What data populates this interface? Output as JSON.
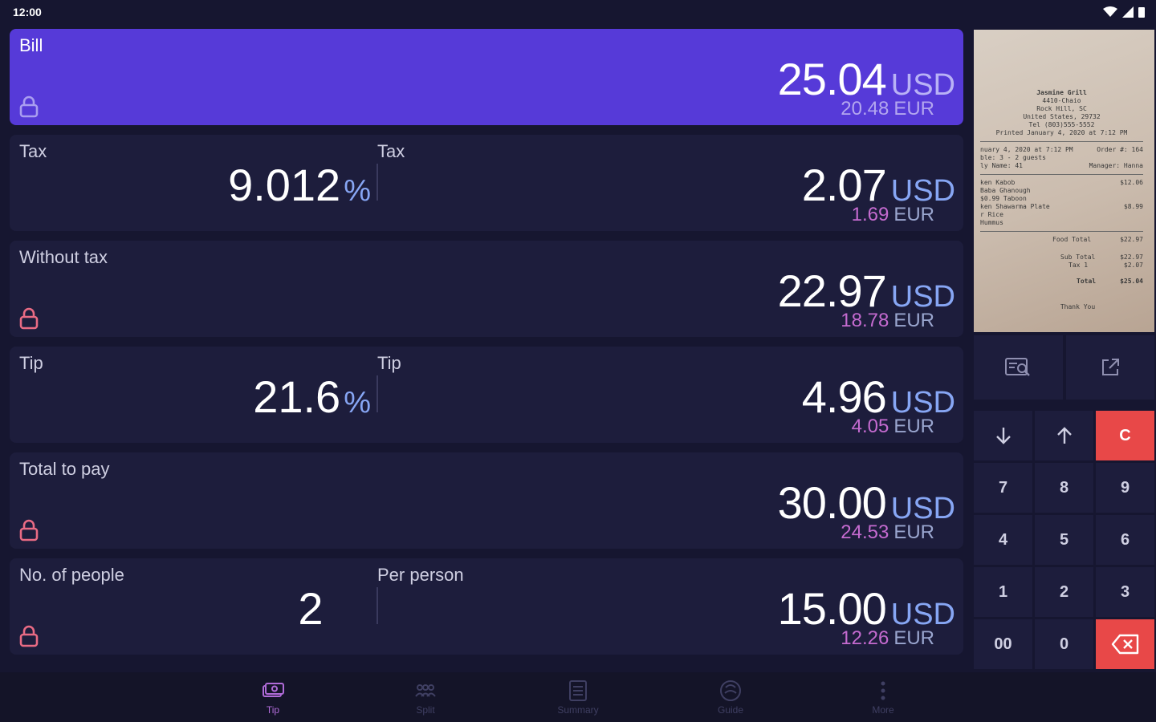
{
  "status": {
    "time": "12:00"
  },
  "bill": {
    "label": "Bill",
    "amount": "25.04",
    "currency": "USD",
    "converted": "20.48",
    "converted_currency": "EUR"
  },
  "tax": {
    "label_left": "Tax",
    "percent": "9.012",
    "percent_symbol": "%",
    "label_right": "Tax",
    "amount": "2.07",
    "currency": "USD",
    "converted": "1.69",
    "converted_currency": "EUR"
  },
  "without_tax": {
    "label": "Without tax",
    "amount": "22.97",
    "currency": "USD",
    "converted": "18.78",
    "converted_currency": "EUR"
  },
  "tip": {
    "label_left": "Tip",
    "percent": "21.6",
    "percent_symbol": "%",
    "label_right": "Tip",
    "amount": "4.96",
    "currency": "USD",
    "converted": "4.05",
    "converted_currency": "EUR"
  },
  "total": {
    "label": "Total to pay",
    "amount": "30.00",
    "currency": "USD",
    "converted": "24.53",
    "converted_currency": "EUR"
  },
  "people": {
    "label_left": "No. of people",
    "count": "2",
    "label_right": "Per person",
    "amount": "15.00",
    "currency": "USD",
    "converted": "12.26",
    "converted_currency": "EUR"
  },
  "receipt": {
    "header": [
      "Jasmine Grill",
      "4410-Chaio",
      "Rock Hill, SC",
      "United States, 29732",
      "Tel (803)555-5552",
      "Printed January 4, 2020 at 7:12 PM"
    ],
    "meta_rows": [
      [
        "nuary 4, 2020 at 7:12 PM",
        "Order #: 164"
      ],
      [
        "ble: 3 - 2 guests",
        ""
      ],
      [
        "ly Name: 41",
        "Manager: Hanna"
      ]
    ],
    "items": [
      [
        "ken Kabob",
        "$12.06"
      ],
      [
        "Baba Ghanough",
        ""
      ],
      [
        "$0.99 Taboon",
        ""
      ],
      [
        "ken Shawarma Plate",
        "$8.99"
      ],
      [
        "r Rice",
        ""
      ],
      [
        "Hummus",
        ""
      ]
    ],
    "totals": [
      [
        "Food Total",
        "$22.97"
      ],
      [
        "Sub Total",
        "$22.97"
      ],
      [
        "Tax 1",
        "$2.07"
      ],
      [
        "Total",
        "$25.04"
      ]
    ],
    "footer": "Thank You"
  },
  "keypad": {
    "down": "↓",
    "up": "↑",
    "clear": "C",
    "digits": [
      "7",
      "8",
      "9",
      "4",
      "5",
      "6",
      "1",
      "2",
      "3"
    ],
    "double_zero": "00",
    "zero": "0"
  },
  "nav": [
    {
      "label": "Tip",
      "icon": "money-icon",
      "active": true
    },
    {
      "label": "Split",
      "icon": "split-icon",
      "active": false
    },
    {
      "label": "Summary",
      "icon": "summary-icon",
      "active": false
    },
    {
      "label": "Guide",
      "icon": "guide-icon",
      "active": false
    },
    {
      "label": "More",
      "icon": "more-icon",
      "active": false
    }
  ],
  "colors": {
    "accent": "#563ad8",
    "card": "#1d1d3c",
    "background": "#161630",
    "danger": "#e84848",
    "lock": "#e96b84",
    "currency": "#87a6f4"
  }
}
